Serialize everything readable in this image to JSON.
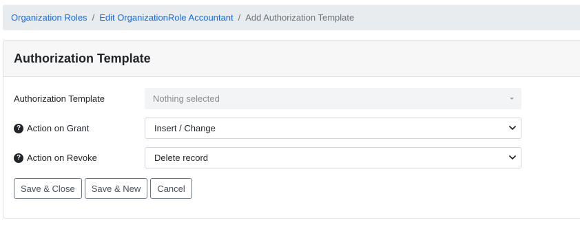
{
  "breadcrumb": {
    "items": [
      "Organization Roles",
      "Edit OrganizationRole Accountant"
    ],
    "current": "Add Authorization Template",
    "separator": "/"
  },
  "card": {
    "title": "Authorization Template"
  },
  "form": {
    "template": {
      "label": "Authorization Template",
      "value": "Nothing selected"
    },
    "grant": {
      "label": "Action on Grant",
      "value": "Insert / Change",
      "help_icon": "question-circle-icon"
    },
    "revoke": {
      "label": "Action on Revoke",
      "value": "Delete record",
      "help_icon": "question-circle-icon"
    }
  },
  "buttons": {
    "save_close": "Save & Close",
    "save_new": "Save & New",
    "cancel": "Cancel"
  },
  "colors": {
    "link": "#0d6efd",
    "breadcrumb_bg": "#e9ecef",
    "header_bg": "#f7f7f7"
  }
}
